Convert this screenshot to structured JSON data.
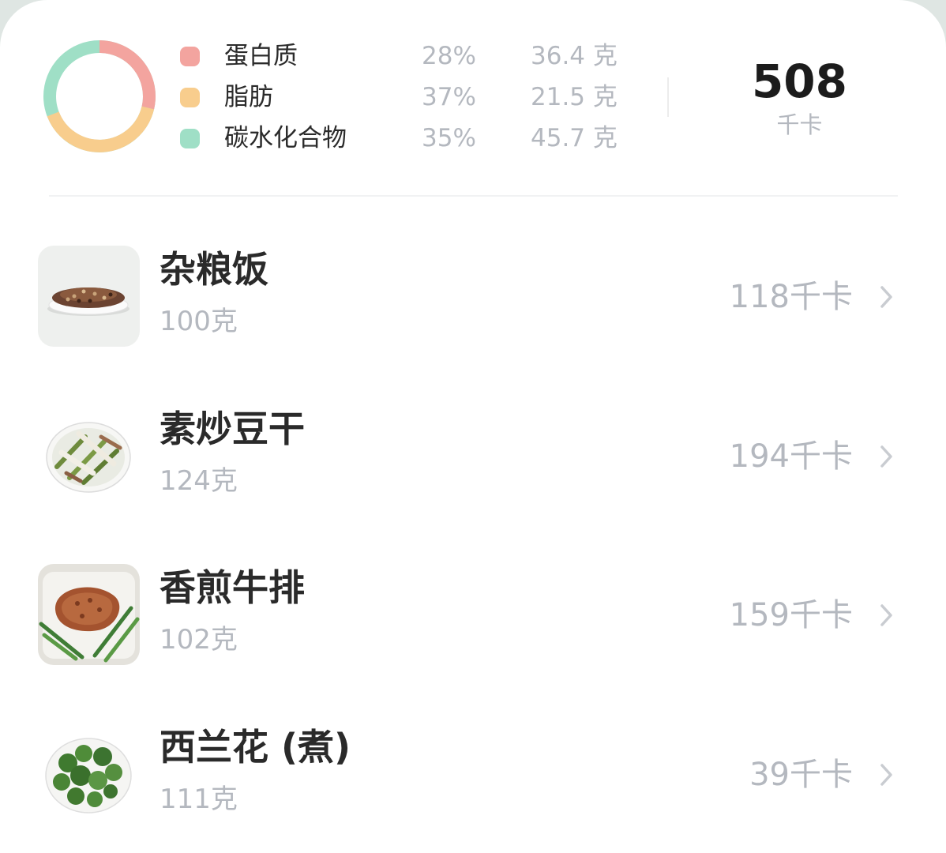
{
  "summary": {
    "macros": [
      {
        "name": "蛋白质",
        "percent": "28%",
        "grams": "36.4 克",
        "color": "#f3a49f",
        "share": 0.28
      },
      {
        "name": "脂肪",
        "percent": "37%",
        "grams": "21.5 克",
        "color": "#f8cd8d",
        "share": 0.37
      },
      {
        "name": "碳水化合物",
        "percent": "35%",
        "grams": "45.7 克",
        "color": "#9fdfc6",
        "share": 0.35
      }
    ],
    "total_kcal": "508",
    "kcal_unit": "千卡"
  },
  "foods": [
    {
      "name": "杂粮饭",
      "amount": "100克",
      "kcal": "118千卡",
      "thumb_icon": "mixed-grain-rice-photo"
    },
    {
      "name": "素炒豆干",
      "amount": "124克",
      "kcal": "194千卡",
      "thumb_icon": "stir-fried-tofu-photo"
    },
    {
      "name": "香煎牛排",
      "amount": "102克",
      "kcal": "159千卡",
      "thumb_icon": "pan-fried-steak-photo"
    },
    {
      "name": "西兰花 (煮)",
      "amount": "111克",
      "kcal": "39千卡",
      "thumb_icon": "boiled-broccoli-photo"
    }
  ],
  "colors": {
    "accent_text": "#2a2a2a",
    "muted_text": "#b4b8bf"
  }
}
